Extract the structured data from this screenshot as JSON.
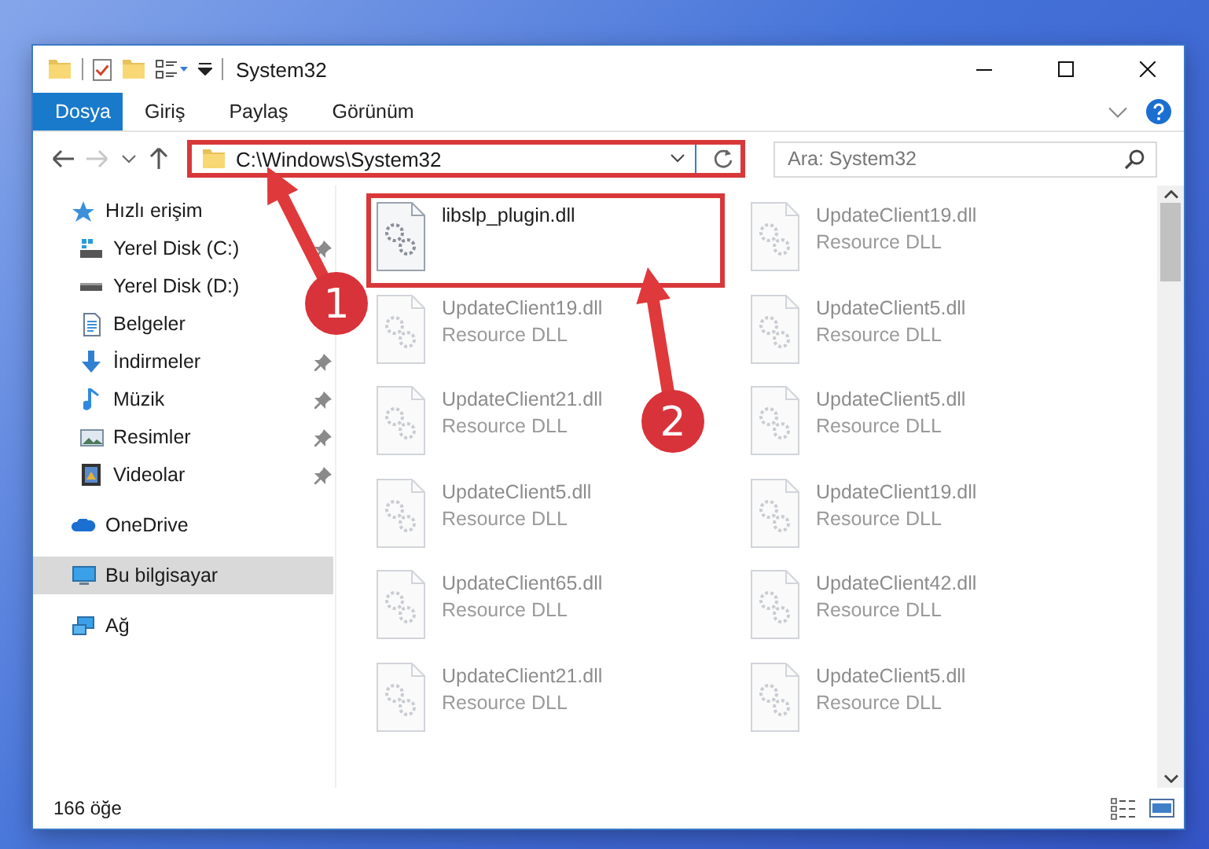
{
  "window": {
    "title": "System32"
  },
  "ribbon_tabs": [
    {
      "label": "Dosya",
      "kind": "file"
    },
    {
      "label": "Giriş",
      "kind": "tab"
    },
    {
      "label": "Paylaş",
      "kind": "tab"
    },
    {
      "label": "Görünüm",
      "kind": "tab"
    }
  ],
  "address_bar": {
    "path": "C:\\Windows\\System32",
    "highlighted": true
  },
  "search": {
    "placeholder": "Ara: System32"
  },
  "sidebar": {
    "items": [
      {
        "label": "Hızlı erişim",
        "kind": "quickaccess",
        "selected": false,
        "children": [
          {
            "label": "Yerel Disk (C:)",
            "kind": "systemdrive",
            "pinned": true
          },
          {
            "label": "Yerel Disk (D:)",
            "kind": "drive",
            "pinned": false
          },
          {
            "label": "Belgeler",
            "kind": "documents",
            "pinned": false
          },
          {
            "label": "İndirmeler",
            "kind": "downloads",
            "pinned": true
          },
          {
            "label": "Müzik",
            "kind": "music",
            "pinned": true
          },
          {
            "label": "Resimler",
            "kind": "pictures",
            "pinned": true
          },
          {
            "label": "Videolar",
            "kind": "videos",
            "pinned": true
          }
        ]
      },
      {
        "label": "OneDrive",
        "kind": "cloud",
        "selected": false
      },
      {
        "label": "Bu bilgisayar",
        "kind": "computer",
        "selected": true
      },
      {
        "label": "Ağ",
        "kind": "network",
        "selected": false
      }
    ]
  },
  "files": [
    {
      "name": "libslp_plugin.dll",
      "faded": false,
      "highlighted": true
    },
    {
      "name": "UpdateClient19.dll",
      "type": "Resource DLL",
      "faded": true,
      "highlighted": false
    },
    {
      "name": "UpdateClient19.dll",
      "type": "Resource DLL",
      "faded": true,
      "highlighted": false
    },
    {
      "name": "UpdateClient5.dll",
      "type": "Resource DLL",
      "faded": true,
      "highlighted": false
    },
    {
      "name": "UpdateClient21.dll",
      "type": "Resource DLL",
      "faded": true,
      "highlighted": false
    },
    {
      "name": "UpdateClient5.dll",
      "type": "Resource DLL",
      "faded": true,
      "highlighted": false
    },
    {
      "name": "UpdateClient5.dll",
      "type": "Resource DLL",
      "faded": true,
      "highlighted": false
    },
    {
      "name": "UpdateClient19.dll",
      "type": "Resource DLL",
      "faded": true,
      "highlighted": false
    },
    {
      "name": "UpdateClient65.dll",
      "type": "Resource DLL",
      "faded": true,
      "highlighted": false
    },
    {
      "name": "UpdateClient42.dll",
      "type": "Resource DLL",
      "faded": true,
      "highlighted": false
    },
    {
      "name": "UpdateClient21.dll",
      "type": "Resource DLL",
      "faded": true,
      "highlighted": false
    },
    {
      "name": "UpdateClient5.dll",
      "type": "Resource DLL",
      "faded": true,
      "highlighted": false
    }
  ],
  "status_bar": {
    "item_count": "166 öğe"
  },
  "annotations": [
    {
      "label": "1"
    },
    {
      "label": "2"
    }
  ]
}
